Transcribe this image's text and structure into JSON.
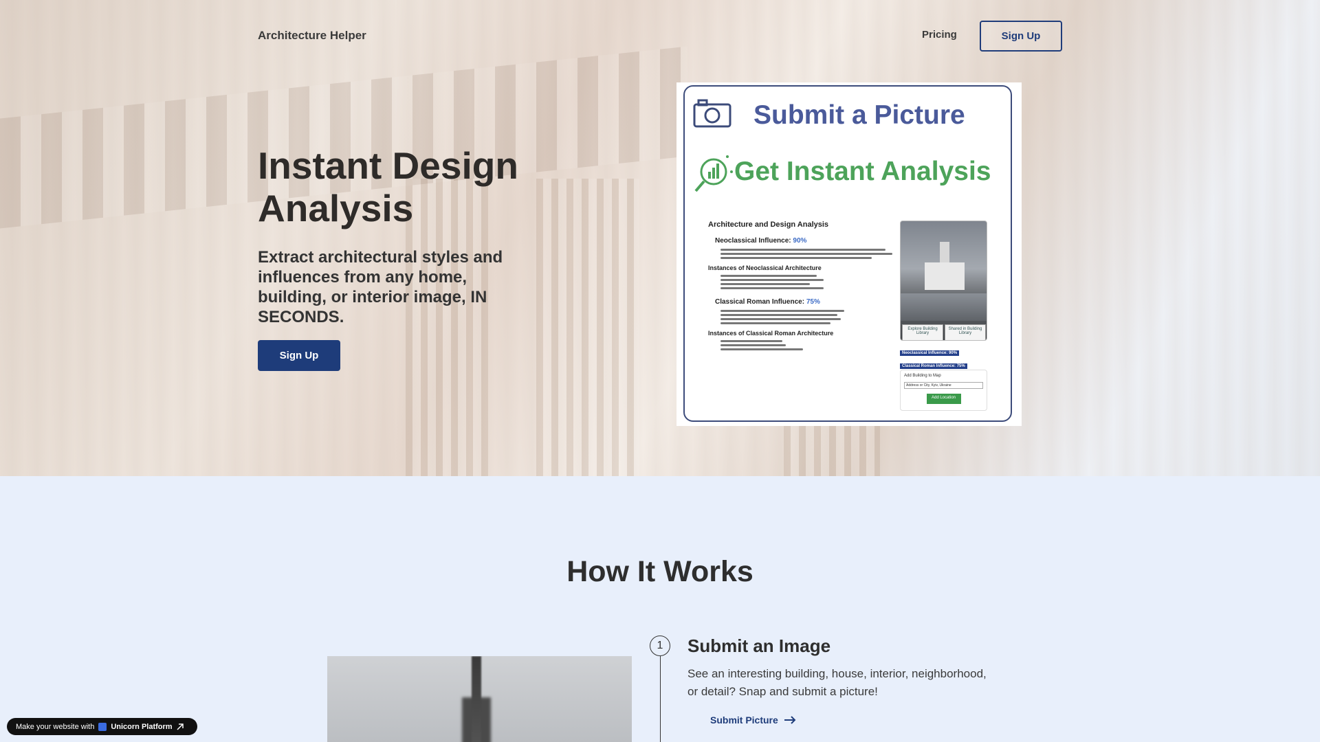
{
  "nav": {
    "brand": "Architecture Helper",
    "pricing": "Pricing",
    "signup": "Sign Up"
  },
  "hero": {
    "title": "Instant Design Analysis",
    "subtitle": "Extract architectural styles and influences from any home, building, or interior image, IN SECONDS.",
    "cta": "Sign Up"
  },
  "preview": {
    "title1": "Submit a Picture",
    "title2": "Get Instant Analysis",
    "doc_heading": "Architecture and Design Analysis",
    "influence1_label": "Neoclassical Influence:",
    "influence1_value": "90%",
    "instances1": "Instances of Neoclassical Architecture",
    "influence2_label": "Classical Roman Influence:",
    "influence2_value": "75%",
    "instances2": "Instances of Classical Roman Architecture",
    "photo_btn1": "Explore Building Library",
    "photo_btn2": "Shared in Building Library",
    "tag1": "Neoclassical Influence: 90%",
    "tag2": "Classical Roman Influence: 75%",
    "map_title": "Add Building to Map",
    "map_input": "Address or City, Kyiv, Ukraine",
    "map_button": "Add Location"
  },
  "how": {
    "title": "How It Works",
    "step_number": "1",
    "step_title": "Submit an Image",
    "step_desc": "See an interesting building, house, interior, neighborhood, or detail? Snap and submit a picture!",
    "step_link": "Submit Picture"
  },
  "badge": {
    "prefix": "Make your website with",
    "brand": "Unicorn Platform"
  },
  "colors": {
    "accent": "#1e3c7a",
    "section_bg": "#e8effb",
    "green": "#4da35a"
  }
}
